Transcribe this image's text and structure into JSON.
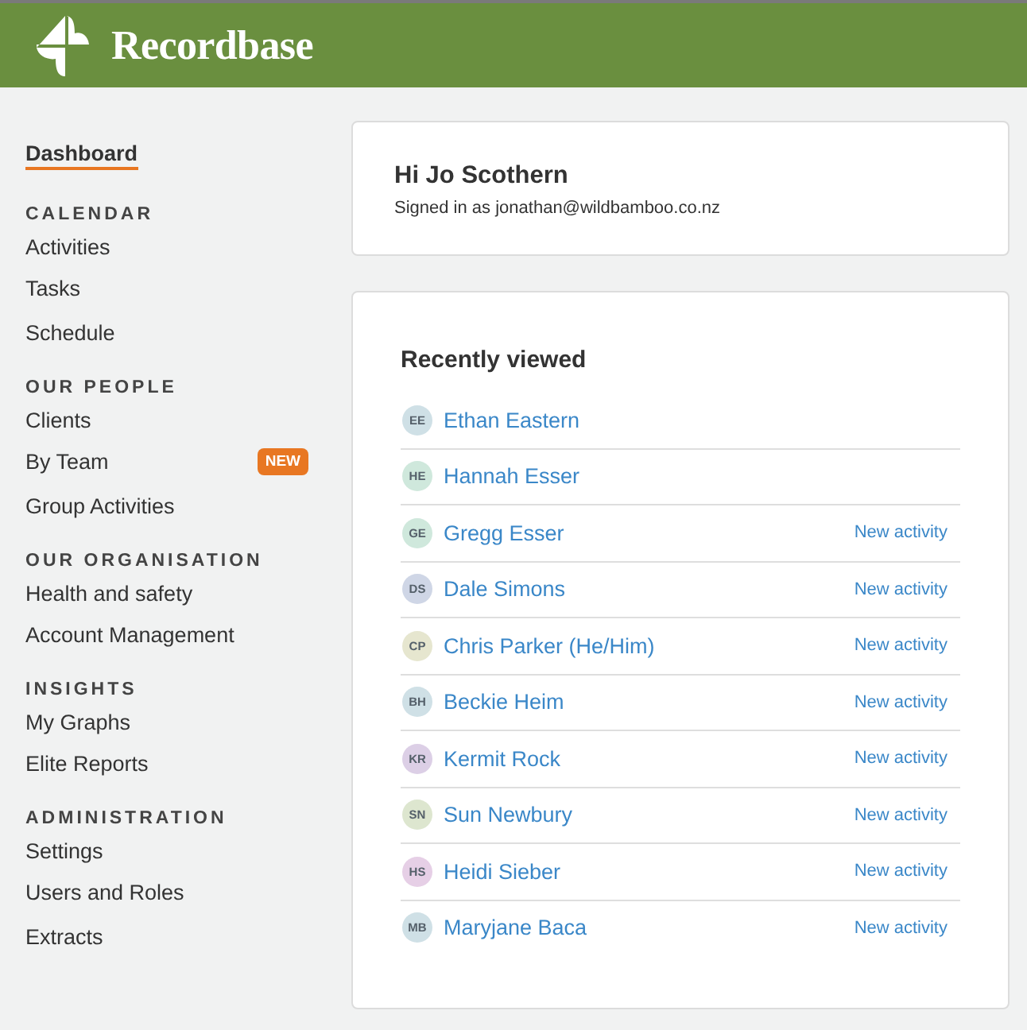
{
  "header": {
    "brand": "Recordbase"
  },
  "sidebar": {
    "sections": [
      {
        "items": [
          {
            "label": "Dashboard",
            "selected": true
          }
        ]
      },
      {
        "heading": "CALENDAR",
        "items": [
          {
            "label": "Activities",
            "selected": false
          },
          {
            "label": "Tasks",
            "selected": false
          },
          {
            "label": "Schedule",
            "selected": false
          }
        ]
      },
      {
        "heading": "OUR PEOPLE",
        "items": [
          {
            "label": "Clients",
            "selected": false
          },
          {
            "label": "By Team",
            "selected": false,
            "badge": "NEW"
          },
          {
            "label": "Group Activities",
            "selected": false
          }
        ]
      },
      {
        "heading": "OUR ORGANISATION",
        "items": [
          {
            "label": "Health and safety",
            "selected": false
          },
          {
            "label": "Account Management",
            "selected": false
          }
        ]
      },
      {
        "heading": "INSIGHTS",
        "items": [
          {
            "label": "My Graphs",
            "selected": false
          },
          {
            "label": "Elite Reports",
            "selected": false
          }
        ]
      },
      {
        "heading": "ADMINISTRATION",
        "items": [
          {
            "label": "Settings",
            "selected": false
          },
          {
            "label": "Users and Roles",
            "selected": false
          },
          {
            "label": "Extracts",
            "selected": false
          }
        ]
      }
    ]
  },
  "greeting": {
    "title": "Hi Jo Scothern",
    "subtitle": "Signed in as jonathan@wildbamboo.co.nz"
  },
  "recently_viewed": {
    "title": "Recently viewed",
    "rows": [
      {
        "initials": "EE",
        "color": "#cfe0e6",
        "name": "Ethan Eastern"
      },
      {
        "initials": "HE",
        "color": "#cfe8dc",
        "name": "Hannah Esser"
      },
      {
        "initials": "GE",
        "color": "#cfe8dc",
        "name": "Gregg Esser",
        "activity": "New activity"
      },
      {
        "initials": "DS",
        "color": "#cfd6e6",
        "name": "Dale Simons",
        "activity": "New activity"
      },
      {
        "initials": "CP",
        "color": "#e6e6cf",
        "name": "Chris Parker (He/Him)",
        "activity": "New activity"
      },
      {
        "initials": "BH",
        "color": "#cfe0e6",
        "name": "Beckie Heim",
        "activity": "New activity"
      },
      {
        "initials": "KR",
        "color": "#dccfe6",
        "name": "Kermit Rock",
        "activity": "New activity"
      },
      {
        "initials": "SN",
        "color": "#dde6cf",
        "name": "Sun Newbury",
        "activity": "New activity"
      },
      {
        "initials": "HS",
        "color": "#e6cfe6",
        "name": "Heidi Sieber",
        "activity": "New activity"
      },
      {
        "initials": "MB",
        "color": "#cfe0e6",
        "name": "Maryjane Baca",
        "activity": "New activity"
      }
    ]
  }
}
